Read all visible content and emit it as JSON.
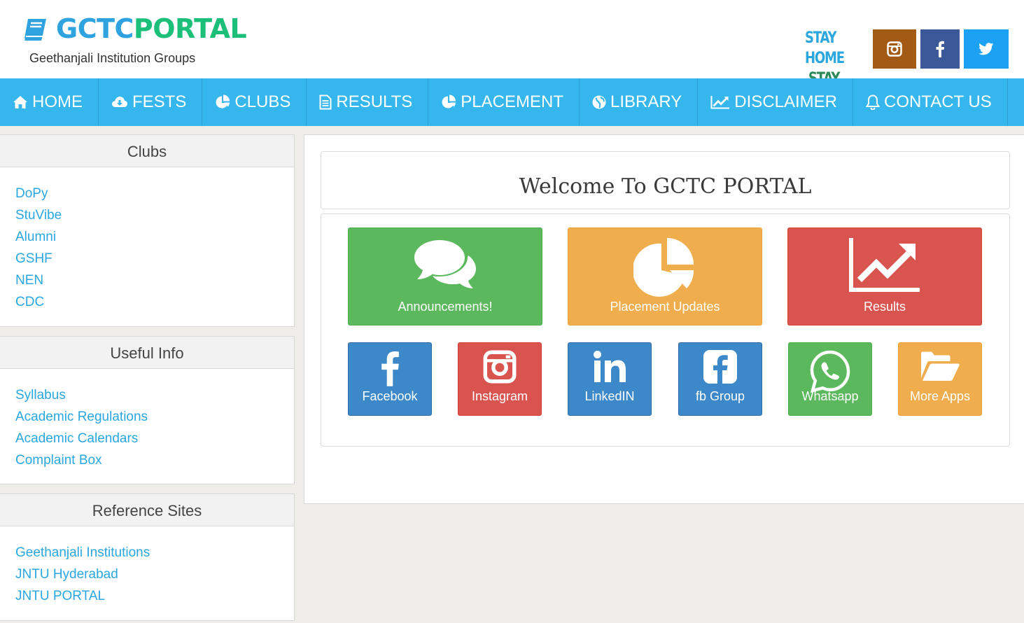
{
  "header": {
    "logo_part1": "GCTC",
    "logo_part2": "PORTAL",
    "tagline": "Geethanjali Institution Groups",
    "stay_line1": "STAY HOME",
    "stay_line2": "STAY SAFE"
  },
  "nav": {
    "items": [
      {
        "label": "HOME",
        "icon": "home-icon"
      },
      {
        "label": "FESTS",
        "icon": "cloud-download-icon"
      },
      {
        "label": "CLUBS",
        "icon": "pie-chart-icon"
      },
      {
        "label": "RESULTS",
        "icon": "file-text-icon"
      },
      {
        "label": "PLACEMENT",
        "icon": "pie-chart-icon"
      },
      {
        "label": "LIBRARY",
        "icon": "globe-icon"
      },
      {
        "label": "DISCLAIMER",
        "icon": "area-chart-icon"
      },
      {
        "label": "CONTACT US",
        "icon": "bell-icon"
      }
    ]
  },
  "sidebar": {
    "clubs": {
      "title": "Clubs",
      "links": [
        "DoPy",
        "StuVibe",
        "Alumni",
        "GSHF",
        "NEN",
        "CDC"
      ]
    },
    "useful": {
      "title": "Useful Info",
      "links": [
        "Syllabus",
        "Academic Regulations",
        "Academic Calendars",
        "Complaint Box"
      ]
    },
    "reference": {
      "title": "Reference Sites",
      "links": [
        "Geethanjali Institutions",
        "JNTU Hyderabad",
        "JNTU PORTAL"
      ]
    }
  },
  "main": {
    "welcome": "Welcome To GCTC PORTAL",
    "big_tiles": [
      {
        "label": "Announcements!",
        "icon": "comments-icon",
        "color": "#5cb85c"
      },
      {
        "label": "Placement Updates",
        "icon": "pie-chart-icon",
        "color": "#f0ad4e"
      },
      {
        "label": "Results",
        "icon": "line-chart-icon",
        "color": "#d9534f"
      }
    ],
    "small_tiles": [
      {
        "label": "Facebook",
        "icon": "facebook-icon",
        "color": "#3c88c8"
      },
      {
        "label": "Instagram",
        "icon": "instagram-icon",
        "color": "#d9534f"
      },
      {
        "label": "LinkedIN",
        "icon": "linkedin-icon",
        "color": "#3c88c8"
      },
      {
        "label": "fb Group",
        "icon": "facebook-square-icon",
        "color": "#3c88c8"
      },
      {
        "label": "Whatsapp",
        "icon": "whatsapp-icon",
        "color": "#5cb85c"
      },
      {
        "label": "More Apps",
        "icon": "folder-open-icon",
        "color": "#f0ad4e"
      }
    ]
  },
  "colors": {
    "nav_bg": "#35b6ec",
    "logo_blue": "#2fa3e0",
    "logo_green": "#1bbf7a",
    "link": "#2aa7e0",
    "instagram_btn": "#a35a14",
    "facebook_btn": "#3b5998",
    "twitter_btn": "#1da1f2"
  }
}
